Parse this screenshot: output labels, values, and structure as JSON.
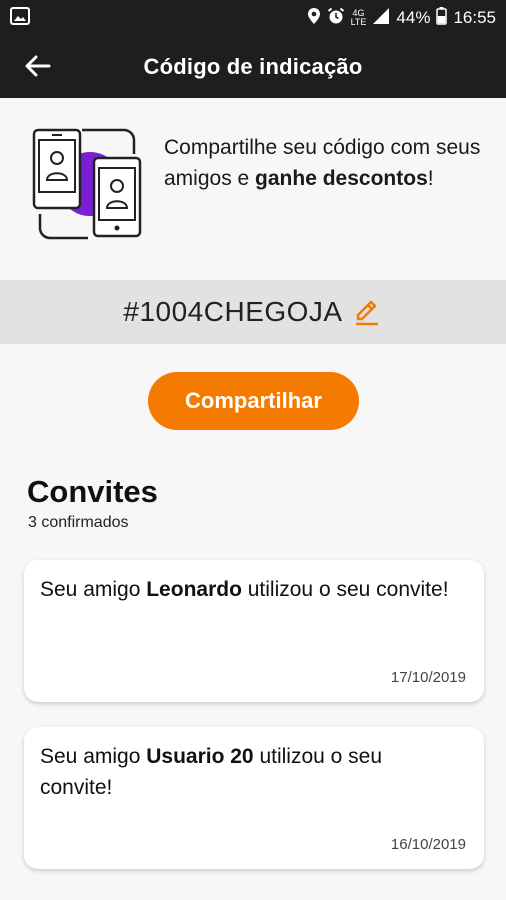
{
  "status_bar": {
    "battery": "44%",
    "time": "16:55",
    "network_top": "4G",
    "network_bottom": "LTE",
    "icons": [
      "image-icon",
      "location-icon",
      "alarm-icon",
      "signal-icon",
      "battery-icon"
    ]
  },
  "app_bar": {
    "title": "Código de indicação",
    "back_icon": "arrow-left-icon"
  },
  "intro": {
    "line_prefix": "Compartilhe seu código com seus",
    "line_middle": "amigos e ",
    "line_bold": "ganhe descontos",
    "line_suffix": "!",
    "illustration": "two-phones-with-user-icon"
  },
  "code": {
    "value": "#1004CHEGOJA",
    "edit_icon": "pencil-icon"
  },
  "share_button": {
    "label": "Compartilhar"
  },
  "invites": {
    "title": "Convites",
    "subtitle": "3 confirmados",
    "items": [
      {
        "prefix": "Seu amigo ",
        "name": "Leonardo",
        "suffix": " utilizou o seu convite!",
        "date": "17/10/2019"
      },
      {
        "prefix": "Seu amigo ",
        "name": "Usuario 20",
        "suffix": " utilizou o seu convite!",
        "date": "16/10/2019"
      }
    ]
  },
  "colors": {
    "accent": "#f47a00",
    "app_bar": "#1e1e1e",
    "code_strip": "#e2e2e2",
    "illustration_purple": "#7a1fd6"
  }
}
